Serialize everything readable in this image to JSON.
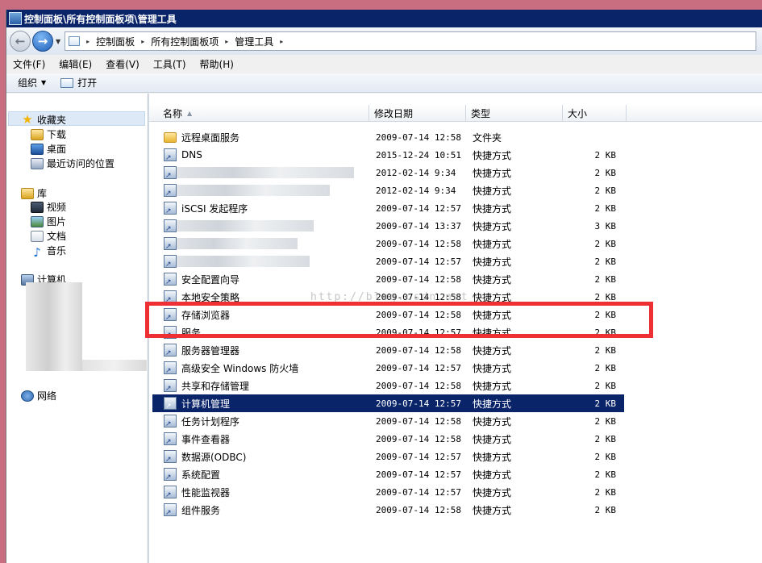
{
  "window": {
    "title": "控制面板\\所有控制面板项\\管理工具"
  },
  "address": {
    "crumbs": [
      "控制面板",
      "所有控制面板项",
      "管理工具"
    ]
  },
  "menu": [
    "文件(F)",
    "编辑(E)",
    "查看(V)",
    "工具(T)",
    "帮助(H)"
  ],
  "toolbar": {
    "organize": "组织",
    "open": "打开"
  },
  "nav": {
    "favorites": "收藏夹",
    "downloads": "下载",
    "desktop": "桌面",
    "recent": "最近访问的位置",
    "libraries": "库",
    "videos": "视频",
    "pictures": "图片",
    "documents": "文档",
    "music": "音乐",
    "computer": "计算机",
    "network": "网络"
  },
  "columns": {
    "name": "名称",
    "date": "修改日期",
    "type": "类型",
    "size": "大小"
  },
  "watermark": "http://blog.csdn.net",
  "files": [
    {
      "name": "远程桌面服务",
      "date": "2009-07-14 12:58",
      "type": "文件夹",
      "size": "",
      "icon": "folder-icon"
    },
    {
      "name": "DNS",
      "date": "2015-12-24 10:51",
      "type": "快捷方式",
      "size": "2 KB",
      "icon": "shortcut-icon"
    },
    {
      "name": "",
      "date": "2012-02-14 9:34",
      "type": "快捷方式",
      "size": "2 KB",
      "icon": "shortcut-icon"
    },
    {
      "name": "",
      "date": "2012-02-14 9:34",
      "type": "快捷方式",
      "size": "2 KB",
      "icon": "shortcut-icon"
    },
    {
      "name": "iSCSI 发起程序",
      "date": "2009-07-14 12:57",
      "type": "快捷方式",
      "size": "2 KB",
      "icon": "shortcut-icon"
    },
    {
      "name": "",
      "date": "2009-07-14 13:37",
      "type": "快捷方式",
      "size": "3 KB",
      "icon": "shortcut-icon"
    },
    {
      "name": "",
      "date": "2009-07-14 12:58",
      "type": "快捷方式",
      "size": "2 KB",
      "icon": "shortcut-icon"
    },
    {
      "name": "",
      "date": "2009-07-14 12:57",
      "type": "快捷方式",
      "size": "2 KB",
      "icon": "shortcut-icon"
    },
    {
      "name": "安全配置向导",
      "date": "2009-07-14 12:58",
      "type": "快捷方式",
      "size": "2 KB",
      "icon": "shortcut-icon"
    },
    {
      "name": "本地安全策略",
      "date": "2009-07-14 12:58",
      "type": "快捷方式",
      "size": "2 KB",
      "icon": "shortcut-icon"
    },
    {
      "name": "存储浏览器",
      "date": "2009-07-14 12:58",
      "type": "快捷方式",
      "size": "2 KB",
      "icon": "shortcut-icon"
    },
    {
      "name": "服务",
      "date": "2009-07-14 12:57",
      "type": "快捷方式",
      "size": "2 KB",
      "icon": "shortcut-icon"
    },
    {
      "name": "服务器管理器",
      "date": "2009-07-14 12:58",
      "type": "快捷方式",
      "size": "2 KB",
      "icon": "shortcut-icon"
    },
    {
      "name": "高级安全 Windows 防火墙",
      "date": "2009-07-14 12:57",
      "type": "快捷方式",
      "size": "2 KB",
      "icon": "shortcut-icon"
    },
    {
      "name": "共享和存储管理",
      "date": "2009-07-14 12:58",
      "type": "快捷方式",
      "size": "2 KB",
      "icon": "shortcut-icon"
    },
    {
      "name": "计算机管理",
      "date": "2009-07-14 12:57",
      "type": "快捷方式",
      "size": "2 KB",
      "icon": "shortcut-icon",
      "selected": true
    },
    {
      "name": "任务计划程序",
      "date": "2009-07-14 12:58",
      "type": "快捷方式",
      "size": "2 KB",
      "icon": "shortcut-icon"
    },
    {
      "name": "事件查看器",
      "date": "2009-07-14 12:58",
      "type": "快捷方式",
      "size": "2 KB",
      "icon": "shortcut-icon"
    },
    {
      "name": "数据源(ODBC)",
      "date": "2009-07-14 12:57",
      "type": "快捷方式",
      "size": "2 KB",
      "icon": "shortcut-icon"
    },
    {
      "name": "系统配置",
      "date": "2009-07-14 12:57",
      "type": "快捷方式",
      "size": "2 KB",
      "icon": "shortcut-icon"
    },
    {
      "name": "性能监视器",
      "date": "2009-07-14 12:57",
      "type": "快捷方式",
      "size": "2 KB",
      "icon": "shortcut-icon"
    },
    {
      "name": "组件服务",
      "date": "2009-07-14 12:58",
      "type": "快捷方式",
      "size": "2 KB",
      "icon": "shortcut-icon"
    }
  ]
}
